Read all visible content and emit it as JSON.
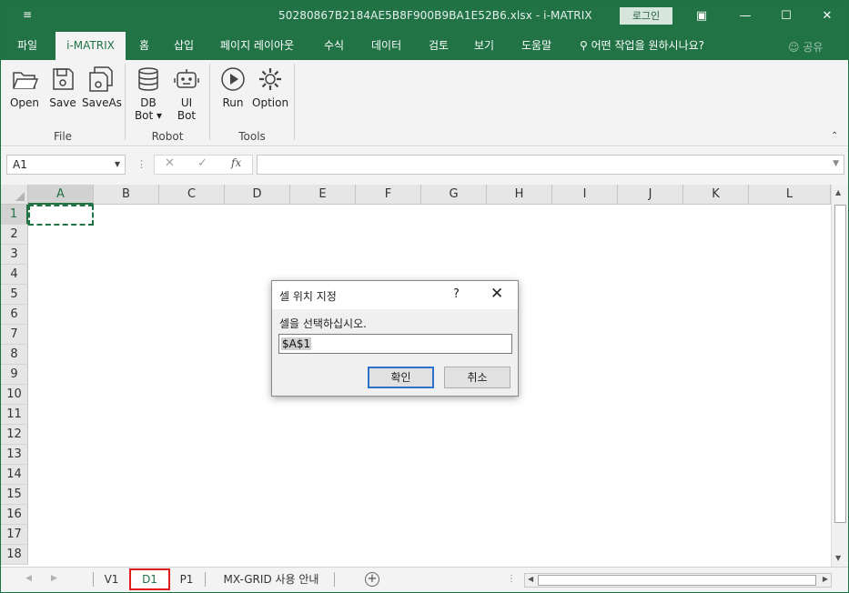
{
  "window": {
    "title": "50280867B2184AE5B8F900B9BA1E52B6.xlsx  -  i-MATRIX",
    "login_label": "로그인",
    "qat_icon": "customize-qat-icon"
  },
  "tabs": [
    {
      "label": "파일"
    },
    {
      "label": "i-MATRIX"
    },
    {
      "label": "홈"
    },
    {
      "label": "삽입"
    },
    {
      "label": "페이지 레이아웃"
    },
    {
      "label": "수식"
    },
    {
      "label": "데이터"
    },
    {
      "label": "검토"
    },
    {
      "label": "보기"
    },
    {
      "label": "도움말"
    },
    {
      "label": "어떤 작업을 원하시나요?"
    }
  ],
  "share_label": "공유",
  "ribbon": {
    "groups": [
      {
        "label": "File",
        "buttons": [
          {
            "label": "Open"
          },
          {
            "label": "Save"
          },
          {
            "label": "SaveAs"
          }
        ]
      },
      {
        "label": "Robot",
        "buttons": [
          {
            "label": "DB",
            "label2": "Bot ▾"
          },
          {
            "label": "UI",
            "label2": "Bot"
          }
        ]
      },
      {
        "label": "Tools",
        "buttons": [
          {
            "label": "Run"
          },
          {
            "label": "Option"
          }
        ]
      }
    ]
  },
  "formula_bar": {
    "name_box": "A1",
    "formula": ""
  },
  "sheet": {
    "columns": [
      "A",
      "B",
      "C",
      "D",
      "E",
      "F",
      "G",
      "H",
      "I",
      "J",
      "K",
      "L"
    ],
    "rows": [
      "1",
      "2",
      "3",
      "4",
      "5",
      "6",
      "7",
      "8",
      "9",
      "10",
      "11",
      "12",
      "13",
      "14",
      "15",
      "16",
      "17",
      "18"
    ],
    "selected_column": "A",
    "selected_row": "1"
  },
  "sheet_tabs": [
    {
      "label": "V1"
    },
    {
      "label": "D1"
    },
    {
      "label": "P1"
    },
    {
      "label": "MX-GRID 사용 안내"
    }
  ],
  "active_sheet": "D1",
  "dialog": {
    "title": "셀 위치 지정",
    "help": "?",
    "close": "✕",
    "prompt": "셀을 선택하십시오.",
    "input_value": "$A$1",
    "ok_label": "확인",
    "cancel_label": "취소"
  },
  "colors": {
    "accent": "#217346",
    "highlight_border": "#e21b1b",
    "dialog_focus": "#2b72c8"
  }
}
